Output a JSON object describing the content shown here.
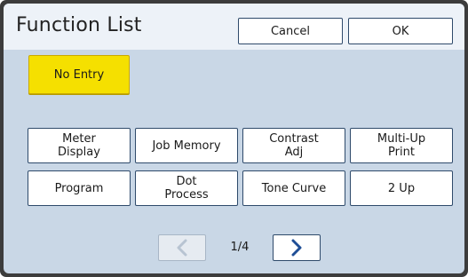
{
  "header": {
    "title": "Function List",
    "cancel_label": "Cancel",
    "ok_label": "OK"
  },
  "no_entry_label": "No Entry",
  "functions": [
    {
      "line1": "Meter",
      "line2": "Display"
    },
    {
      "line1": "Job Memory",
      "line2": ""
    },
    {
      "line1": "Contrast",
      "line2": "Adj"
    },
    {
      "line1": "Multi-Up",
      "line2": "Print"
    },
    {
      "line1": "Program",
      "line2": ""
    },
    {
      "line1": "Dot",
      "line2": "Process"
    },
    {
      "line1": "Tone Curve",
      "line2": ""
    },
    {
      "line1": "2 Up",
      "line2": ""
    }
  ],
  "pager": {
    "text": "1/4",
    "prev_icon": "chevron-left-icon",
    "next_icon": "chevron-right-icon"
  },
  "colors": {
    "accent_yellow": "#f5e000",
    "panel": "#c9d7e6",
    "header": "#edf2f8",
    "chevron": "#1f4e96",
    "chevron_disabled": "#b8c4d2"
  }
}
